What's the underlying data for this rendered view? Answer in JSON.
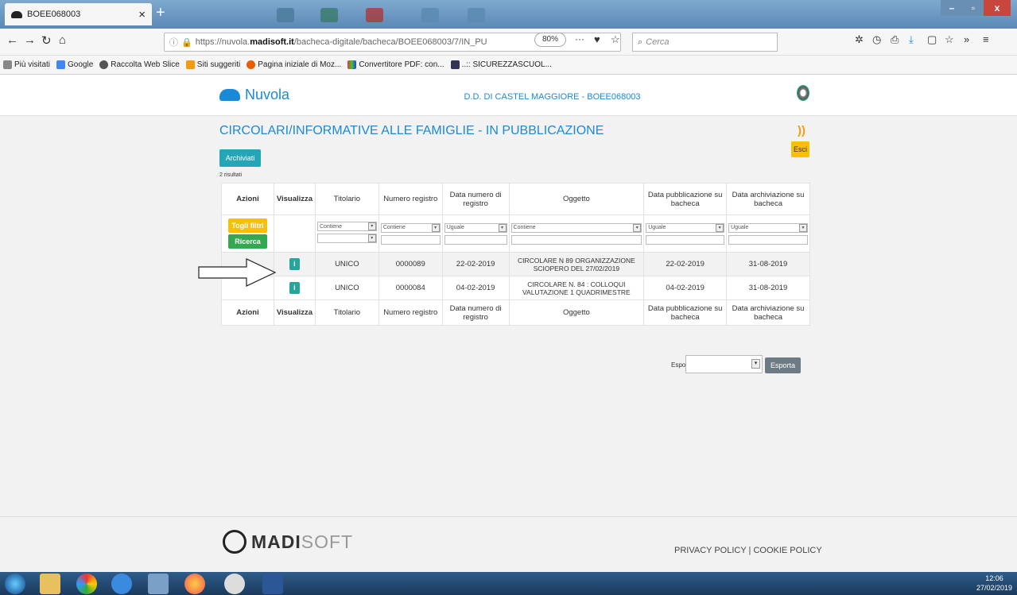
{
  "browser": {
    "tab_title": "BOEE068003",
    "new_tab": "+",
    "url_prefix": "https://nuvola.",
    "url_domain": "madisoft.it",
    "url_path": "/bacheca-digitale/bacheca/BOEE068003/7/IN_PU",
    "zoom": "80%",
    "search_placeholder": "Cerca",
    "bookmarks": [
      "Più visitati",
      "Google",
      "Raccolta Web Slice",
      "Siti suggeriti",
      "Pagina iniziale di Moz...",
      "Convertitore PDF: con...",
      "..:: SICUREZZASCUOL..."
    ]
  },
  "app": {
    "logo": "Nuvola",
    "school": "D.D. DI CASTEL MAGGIORE - BOEE068003",
    "page_title": "CIRCOLARI/INFORMATIVE ALLE FAMIGLIE - IN PUBBLICAZIONE",
    "esci": "Esci",
    "archiviati": "Archiviati",
    "count": "2 risultati",
    "columns": [
      "Azioni",
      "Visualizza",
      "Titolario",
      "Numero registro",
      "Data numero di registro",
      "Oggetto",
      "Data pubblicazione su bacheca",
      "Data archiviazione su bacheca"
    ],
    "filters": {
      "togli": "Togli filtri",
      "ricerca": "Ricerca",
      "contiene": "Contiene",
      "uguale": "Uguale"
    },
    "rows": [
      {
        "info": "i",
        "titolario": "UNICO",
        "numero": "0000089",
        "data_num": "22-02-2019",
        "oggetto": "CIRCOLARE N 89 ORGANIZZAZIONE SCIOPERO DEL 27/02/2019",
        "data_pub": "22-02-2019",
        "data_arch": "31-08-2019"
      },
      {
        "info": "i",
        "titolario": "UNICO",
        "numero": "0000084",
        "data_num": "04-02-2019",
        "oggetto": "CIRCOLARE N. 84 : COLLOQUI VALUTAZIONE 1 QUADRIMESTRE",
        "data_pub": "04-02-2019",
        "data_arch": "31-08-2019"
      }
    ],
    "esporta_label": "Esporta",
    "esporta_button": "Esporta"
  },
  "footer": {
    "brand_bold": "MADI",
    "brand_light": "SOFT",
    "privacy": "PRIVACY POLICY",
    "separator": "|",
    "cookie": "COOKIE POLICY"
  },
  "taskbar": {
    "time": "12:06",
    "date": "27/02/2019"
  }
}
